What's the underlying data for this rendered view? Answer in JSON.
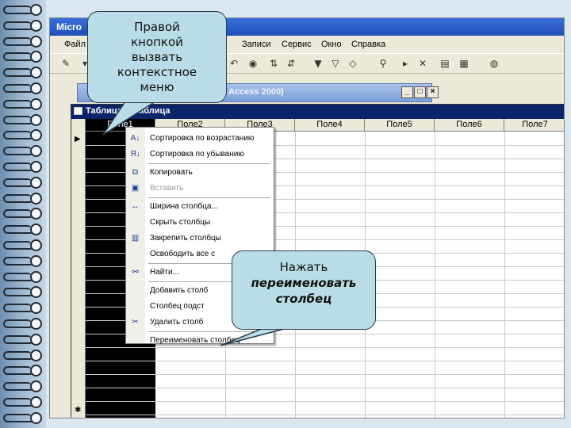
{
  "window": {
    "title": "Micro"
  },
  "menu": {
    "items": [
      "Файл",
      "Записи",
      "Сервис",
      "Окно",
      "Справка"
    ]
  },
  "db_window": {
    "title": "Access 2000)"
  },
  "table_window": {
    "title": "Таблица1 : таблица"
  },
  "columns": [
    "Поле1",
    "Поле2",
    "Поле3",
    "Поле4",
    "Поле5",
    "Поле6",
    "Поле7"
  ],
  "context_menu": {
    "items": [
      {
        "label": "Сортировка по возрастанию",
        "icon": "sort-ascending-icon",
        "disabled": false
      },
      {
        "label": "Сортировка по убыванию",
        "icon": "sort-descending-icon",
        "disabled": false
      },
      {
        "label": "Копировать",
        "icon": "copy-icon",
        "disabled": false
      },
      {
        "label": "Вставить",
        "icon": "paste-icon",
        "disabled": true
      },
      {
        "label": "Ширина столбца...",
        "icon": "column-width-icon",
        "disabled": false
      },
      {
        "label": "Скрыть столбцы",
        "icon": "",
        "disabled": false
      },
      {
        "label": "Закрепить столбцы",
        "icon": "freeze-columns-icon",
        "disabled": false
      },
      {
        "label": "Освободить все с",
        "icon": "",
        "disabled": false
      },
      {
        "label": "Найти...",
        "icon": "binoculars-icon",
        "disabled": false
      },
      {
        "label": "Добавить столб",
        "icon": "",
        "disabled": false
      },
      {
        "label": "Столбец подст",
        "icon": "",
        "disabled": false
      },
      {
        "label": "Удалить столб",
        "icon": "delete-column-icon",
        "disabled": false
      },
      {
        "label": "Переименовать столбец",
        "icon": "",
        "disabled": false
      }
    ]
  },
  "callouts": {
    "top_line1": "Правой",
    "top_line2": "кнопкой",
    "top_line3": "вызвать",
    "top_line4": "контекстное",
    "top_line5": "меню",
    "bottom_line1": "Нажать",
    "bottom_line2": "переименовать",
    "bottom_line3": "столбец"
  },
  "colors": {
    "accent": "#0a246a",
    "callout_fill": "#b9dde6",
    "selected_column": "#000000"
  }
}
